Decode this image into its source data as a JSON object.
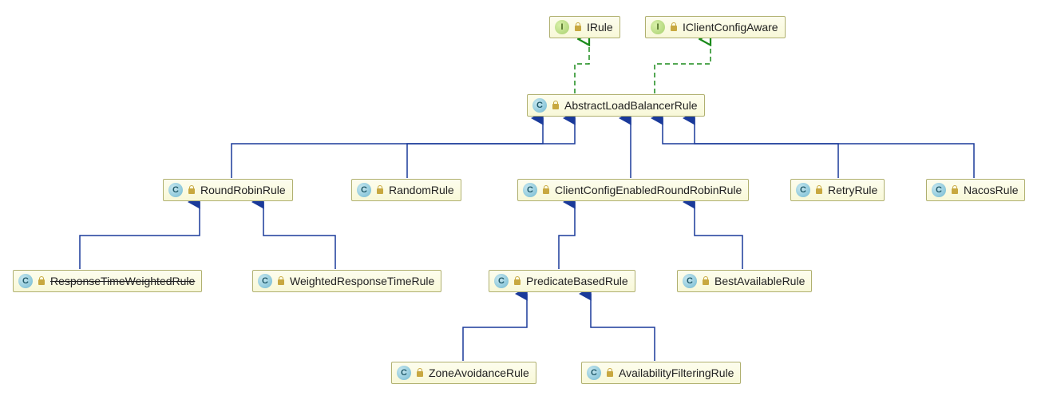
{
  "chart_data": {
    "type": "uml_class_hierarchy",
    "nodes": [
      {
        "id": "IRule",
        "name": "IRule",
        "kind": "interface"
      },
      {
        "id": "IClientConfigAware",
        "name": "IClientConfigAware",
        "kind": "interface"
      },
      {
        "id": "AbstractLoadBalancerRule",
        "name": "AbstractLoadBalancerRule",
        "kind": "class"
      },
      {
        "id": "RoundRobinRule",
        "name": "RoundRobinRule",
        "kind": "class"
      },
      {
        "id": "RandomRule",
        "name": "RandomRule",
        "kind": "class"
      },
      {
        "id": "ClientConfigEnabledRoundRobinRule",
        "name": "ClientConfigEnabledRoundRobinRule",
        "kind": "class"
      },
      {
        "id": "RetryRule",
        "name": "RetryRule",
        "kind": "class"
      },
      {
        "id": "NacosRule",
        "name": "NacosRule",
        "kind": "class"
      },
      {
        "id": "ResponseTimeWeightedRule",
        "name": "ResponseTimeWeightedRule",
        "kind": "class",
        "deprecated": true
      },
      {
        "id": "WeightedResponseTimeRule",
        "name": "WeightedResponseTimeRule",
        "kind": "class"
      },
      {
        "id": "PredicateBasedRule",
        "name": "PredicateBasedRule",
        "kind": "class"
      },
      {
        "id": "BestAvailableRule",
        "name": "BestAvailableRule",
        "kind": "class"
      },
      {
        "id": "ZoneAvoidanceRule",
        "name": "ZoneAvoidanceRule",
        "kind": "class"
      },
      {
        "id": "AvailabilityFilteringRule",
        "name": "AvailabilityFilteringRule",
        "kind": "class"
      }
    ],
    "edges": [
      {
        "from": "AbstractLoadBalancerRule",
        "to": "IRule",
        "type": "implements"
      },
      {
        "from": "AbstractLoadBalancerRule",
        "to": "IClientConfigAware",
        "type": "implements"
      },
      {
        "from": "RoundRobinRule",
        "to": "AbstractLoadBalancerRule",
        "type": "extends"
      },
      {
        "from": "RandomRule",
        "to": "AbstractLoadBalancerRule",
        "type": "extends"
      },
      {
        "from": "ClientConfigEnabledRoundRobinRule",
        "to": "AbstractLoadBalancerRule",
        "type": "extends"
      },
      {
        "from": "RetryRule",
        "to": "AbstractLoadBalancerRule",
        "type": "extends"
      },
      {
        "from": "NacosRule",
        "to": "AbstractLoadBalancerRule",
        "type": "extends"
      },
      {
        "from": "ResponseTimeWeightedRule",
        "to": "RoundRobinRule",
        "type": "extends"
      },
      {
        "from": "WeightedResponseTimeRule",
        "to": "RoundRobinRule",
        "type": "extends"
      },
      {
        "from": "PredicateBasedRule",
        "to": "ClientConfigEnabledRoundRobinRule",
        "type": "extends"
      },
      {
        "from": "BestAvailableRule",
        "to": "ClientConfigEnabledRoundRobinRule",
        "type": "extends"
      },
      {
        "from": "ZoneAvoidanceRule",
        "to": "PredicateBasedRule",
        "type": "extends"
      },
      {
        "from": "AvailabilityFilteringRule",
        "to": "PredicateBasedRule",
        "type": "extends"
      }
    ]
  },
  "nodes": {
    "IRule": {
      "label": "IRule",
      "badge": "I"
    },
    "IClientConfigAware": {
      "label": "IClientConfigAware",
      "badge": "I"
    },
    "AbstractLoadBalancerRule": {
      "label": "AbstractLoadBalancerRule",
      "badge": "C"
    },
    "RoundRobinRule": {
      "label": "RoundRobinRule",
      "badge": "C"
    },
    "RandomRule": {
      "label": "RandomRule",
      "badge": "C"
    },
    "ClientConfigEnabledRoundRobinRule": {
      "label": "ClientConfigEnabledRoundRobinRule",
      "badge": "C"
    },
    "RetryRule": {
      "label": "RetryRule",
      "badge": "C"
    },
    "NacosRule": {
      "label": "NacosRule",
      "badge": "C"
    },
    "ResponseTimeWeightedRule": {
      "label": "ResponseTimeWeightedRule",
      "badge": "C"
    },
    "WeightedResponseTimeRule": {
      "label": "WeightedResponseTimeRule",
      "badge": "C"
    },
    "PredicateBasedRule": {
      "label": "PredicateBasedRule",
      "badge": "C"
    },
    "BestAvailableRule": {
      "label": "BestAvailableRule",
      "badge": "C"
    },
    "ZoneAvoidanceRule": {
      "label": "ZoneAvoidanceRule",
      "badge": "C"
    },
    "AvailabilityFilteringRule": {
      "label": "AvailabilityFilteringRule",
      "badge": "C"
    }
  }
}
